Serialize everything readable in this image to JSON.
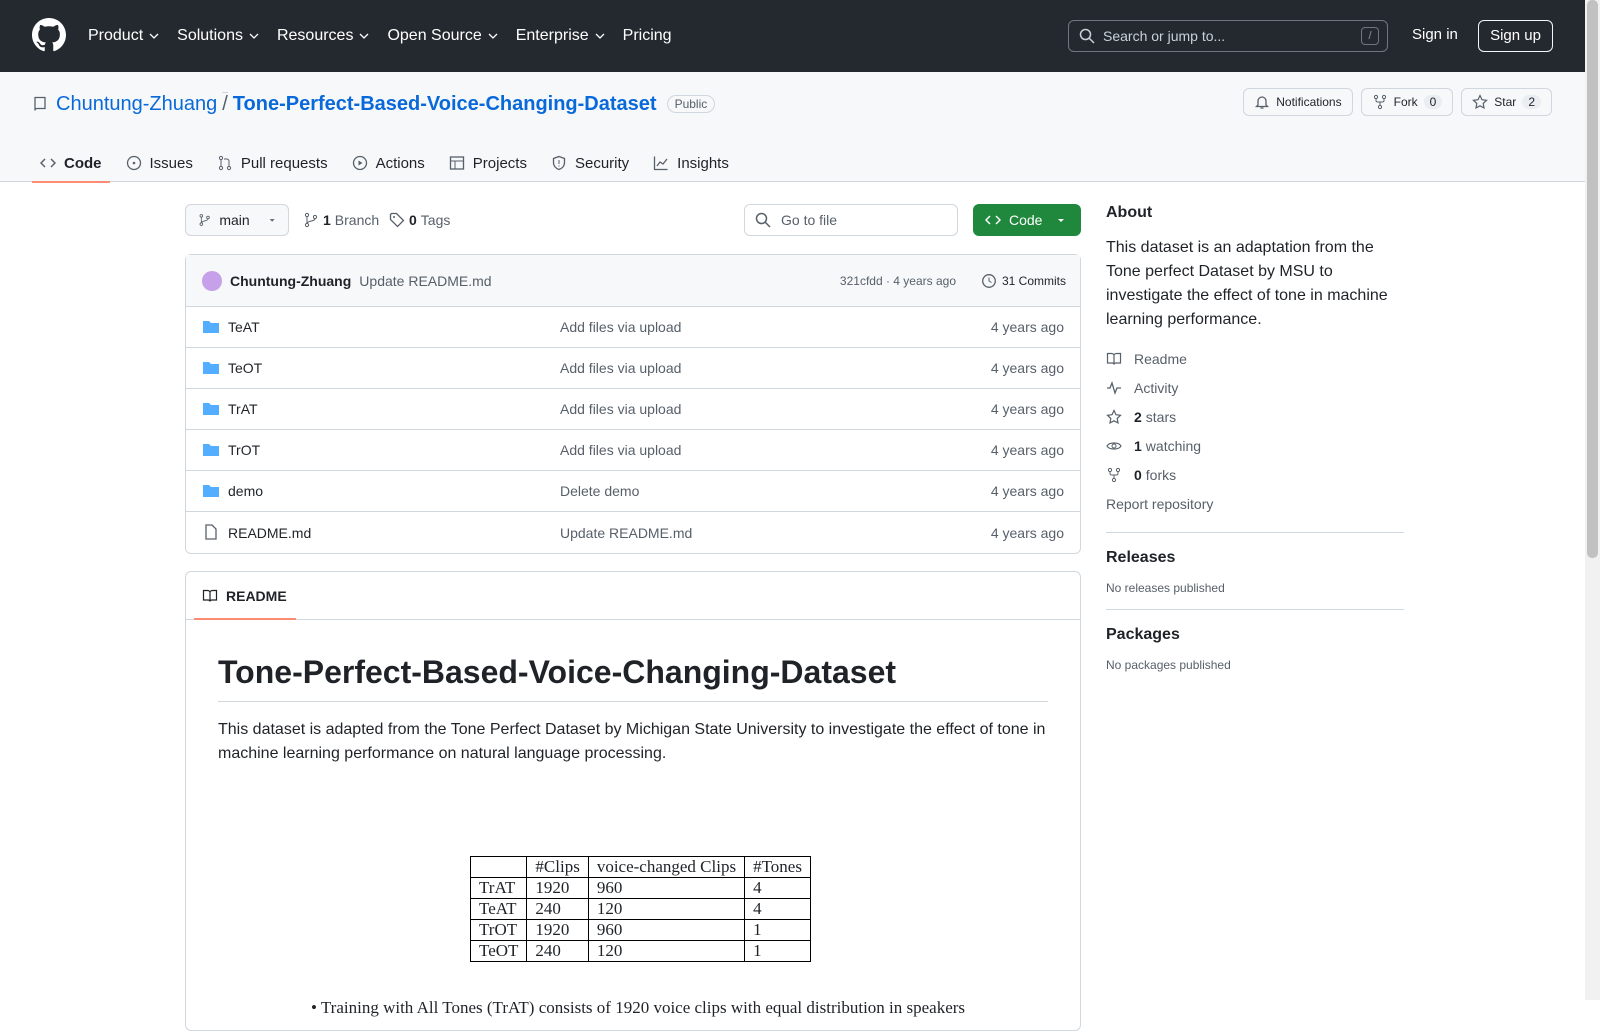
{
  "nav": {
    "items": [
      "Product",
      "Solutions",
      "Resources",
      "Open Source",
      "Enterprise",
      "Pricing"
    ],
    "search_placeholder": "Search or jump to...",
    "search_key": "/",
    "signin": "Sign in",
    "signup": "Sign up"
  },
  "repo": {
    "owner": "Chuntung-Zhuang",
    "sep": "/",
    "name": "Tone-Perfect-Based-Voice-Changing-Dataset",
    "visibility": "Public",
    "notifications": "Notifications",
    "fork_label": "Fork",
    "fork_count": "0",
    "star_label": "Star",
    "star_count": "2"
  },
  "tabs": [
    "Code",
    "Issues",
    "Pull requests",
    "Actions",
    "Projects",
    "Security",
    "Insights"
  ],
  "toolbar": {
    "branch": "main",
    "branch_count": "1",
    "branch_label": "Branch",
    "tag_count": "0",
    "tag_label": "Tags",
    "goto_placeholder": "Go to file",
    "code_label": "Code"
  },
  "commit": {
    "author": "Chuntung-Zhuang",
    "message": "Update README.md",
    "meta": "321cfdd · 4 years ago",
    "count": "31 Commits"
  },
  "files": [
    {
      "name": "TeAT",
      "type": "dir",
      "msg": "Add files via upload",
      "age": "4 years ago"
    },
    {
      "name": "TeOT",
      "type": "dir",
      "msg": "Add files via upload",
      "age": "4 years ago"
    },
    {
      "name": "TrAT",
      "type": "dir",
      "msg": "Add files via upload",
      "age": "4 years ago"
    },
    {
      "name": "TrOT",
      "type": "dir",
      "msg": "Add files via upload",
      "age": "4 years ago"
    },
    {
      "name": "demo",
      "type": "dir",
      "msg": "Delete demo",
      "age": "4 years ago"
    },
    {
      "name": "README.md",
      "type": "file",
      "msg": "Update README.md",
      "age": "4 years ago"
    }
  ],
  "readme": {
    "tab": "README",
    "title": "Tone-Perfect-Based-Voice-Changing-Dataset",
    "para": "This dataset is adapted from the Tone Perfect Dataset by Michigan State University to investigate the effect of tone in machine learning performance on natural language processing.",
    "table": {
      "header": [
        "",
        "#Clips",
        "voice-changed Clips",
        "#Tones"
      ],
      "rows": [
        [
          "TrAT",
          "1920",
          "960",
          "4"
        ],
        [
          "TeAT",
          "240",
          "120",
          "4"
        ],
        [
          "TrOT",
          "1920",
          "960",
          "1"
        ],
        [
          "TeOT",
          "240",
          "120",
          "1"
        ]
      ]
    },
    "bullet": "• Training with All Tones (TrAT) consists of 1920 voice clips with equal distribution in speakers"
  },
  "about": {
    "heading": "About",
    "description": "This dataset is an adaptation from the Tone perfect Dataset by MSU to investigate the effect of tone in machine learning performance.",
    "readme": "Readme",
    "activity": "Activity",
    "stars_n": "2",
    "stars": "stars",
    "watching_n": "1",
    "watching": "watching",
    "forks_n": "0",
    "forks": "forks",
    "report": "Report repository"
  },
  "releases": {
    "heading": "Releases",
    "text": "No releases published"
  },
  "packages": {
    "heading": "Packages",
    "text": "No packages published"
  }
}
